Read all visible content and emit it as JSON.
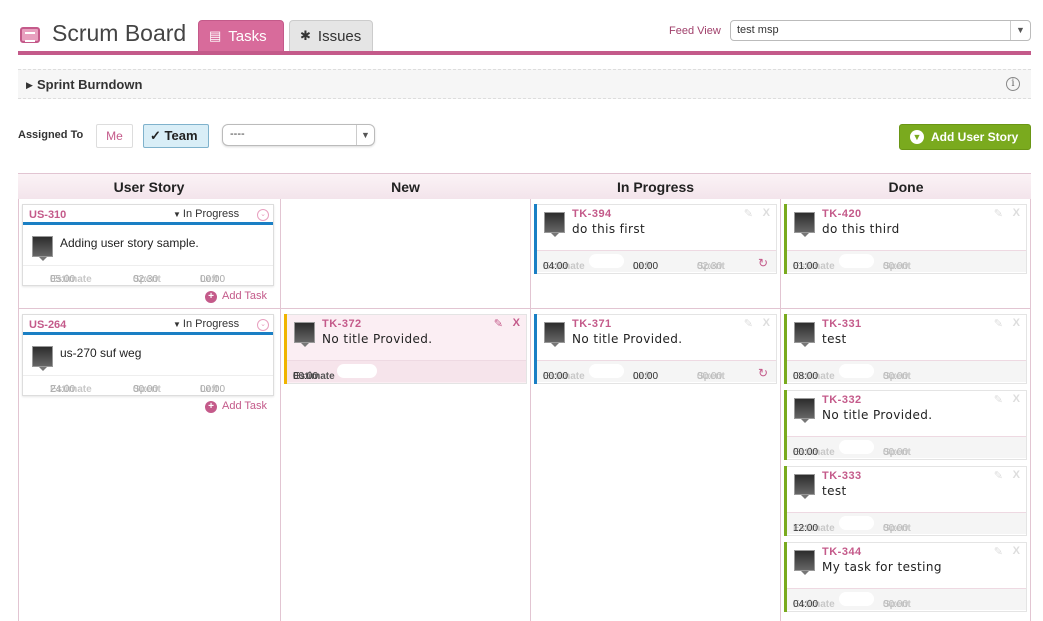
{
  "header": {
    "title": "Scrum Board",
    "tabs": [
      {
        "label": "Tasks",
        "icon": "notepad-icon",
        "active": true
      },
      {
        "label": "Issues",
        "icon": "bug-icon",
        "active": false
      }
    ],
    "feed_view_label": "Feed View",
    "feed_view_value": "test msp"
  },
  "burndown": {
    "title": "Sprint Burndown"
  },
  "filters": {
    "assigned_to_label": "Assigned To",
    "me_label": "Me",
    "team_label": "Team",
    "assignee_value": "----",
    "add_story_label": "Add User Story"
  },
  "columns": [
    "User Story",
    "New",
    "In Progress",
    "Done"
  ],
  "labels": {
    "estimate": "Estimate",
    "spent": "Spent",
    "left": "Left",
    "add_task": "Add Task"
  },
  "stories": [
    {
      "id": "US-310",
      "status": "In Progress",
      "title": "Adding user story sample.",
      "estimate": "05:00",
      "spent": "02:30",
      "left": "00:00"
    },
    {
      "id": "US-264",
      "status": "In Progress",
      "title": "us-270 suf weg",
      "estimate": "24:00",
      "spent": "00:00",
      "left": "00:00"
    }
  ],
  "tasks": {
    "tk394": {
      "id": "TK-394",
      "title": "do this first",
      "estimate": "04:00",
      "left": "00:00",
      "spent": "02:30"
    },
    "tk420": {
      "id": "TK-420",
      "title": "do this third",
      "estimate": "01:00",
      "spent": "00:00"
    },
    "tk372": {
      "id": "TK-372",
      "title": "No title Provided.",
      "estimate": "00:00"
    },
    "tk371": {
      "id": "TK-371",
      "title": "No title Provided.",
      "estimate": "00:00",
      "left": "00:00",
      "spent": "00:00"
    },
    "tk331": {
      "id": "TK-331",
      "title": "test",
      "estimate": "08:00",
      "spent": "00:00"
    },
    "tk332": {
      "id": "TK-332",
      "title": "No title Provided.",
      "estimate": "00:00",
      "spent": "00:00"
    },
    "tk333": {
      "id": "TK-333",
      "title": "test",
      "estimate": "12:00",
      "spent": "00:00"
    },
    "tk344": {
      "id": "TK-344",
      "title": "My task for testing",
      "estimate": "04:00",
      "spent": "00:00"
    }
  },
  "colors": {
    "accent": "#c45a8a",
    "in_progress": "#1a7fc4",
    "done": "#7aaa1e",
    "new": "#f0b400"
  }
}
